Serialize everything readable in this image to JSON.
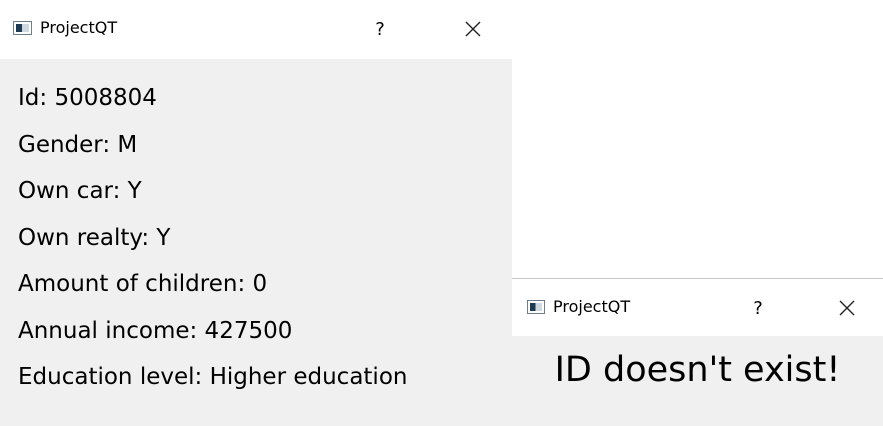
{
  "details_window": {
    "title": "ProjectQT",
    "help_label": "?",
    "icon": "app-window-icon",
    "close_icon": "close-icon",
    "fields": [
      "Id: 5008804",
      "Gender: M",
      "Own car: Y",
      "Own realty: Y",
      "Amount of children: 0",
      "Annual income: 427500",
      "Education level: Higher education"
    ]
  },
  "message_window": {
    "title": "ProjectQT",
    "help_label": "?",
    "icon": "app-window-icon",
    "close_icon": "close-icon",
    "message": "ID doesn't exist!"
  }
}
